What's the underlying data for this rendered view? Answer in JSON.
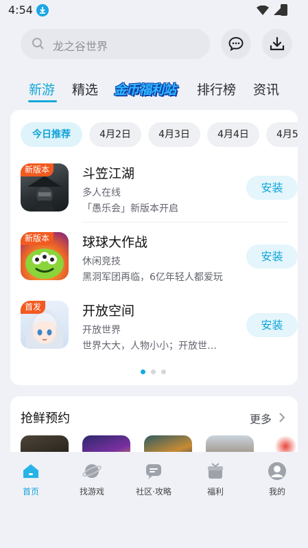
{
  "status_bar": {
    "time": "4:54"
  },
  "search": {
    "placeholder": "龙之谷世界"
  },
  "tabs": [
    {
      "label": "新游",
      "active": true
    },
    {
      "label": "精选"
    },
    {
      "label": "金币福利站",
      "promo": true
    },
    {
      "label": "排行榜"
    },
    {
      "label": "资讯"
    }
  ],
  "date_chips": [
    {
      "label": "今日推荐",
      "active": true
    },
    {
      "label": "4月2日"
    },
    {
      "label": "4月3日"
    },
    {
      "label": "4月4日"
    },
    {
      "label": "4月5"
    }
  ],
  "games": [
    {
      "tag": "新版本",
      "name": "斗笠江湖",
      "category": "多人在线",
      "desc": "「愚乐会」新版本开启",
      "button": "安装"
    },
    {
      "tag": "新版本",
      "name": "球球大作战",
      "category": "休闲竞技",
      "desc": "黑洞军团再临，6亿年轻人都爱玩",
      "button": "安装"
    },
    {
      "tag": "首发",
      "name": "开放空间",
      "category": "开放世界",
      "desc": "世界大大，人物小小；开放世界等你探索",
      "button": "安装"
    }
  ],
  "carousel": {
    "pages": 3,
    "current": 1
  },
  "preorder": {
    "title": "抢鲜预约",
    "more": "更多"
  },
  "bottom_nav": [
    {
      "label": "首页",
      "icon": "home-icon",
      "active": true
    },
    {
      "label": "找游戏",
      "icon": "planet-icon"
    },
    {
      "label": "社区·攻略",
      "icon": "chat-icon"
    },
    {
      "label": "福利",
      "icon": "gift-icon"
    },
    {
      "label": "我的",
      "icon": "profile-icon"
    }
  ],
  "colors": {
    "accent": "#12a8d8",
    "tag": "#f25a1f",
    "install_bg": "#e4f5fc"
  }
}
